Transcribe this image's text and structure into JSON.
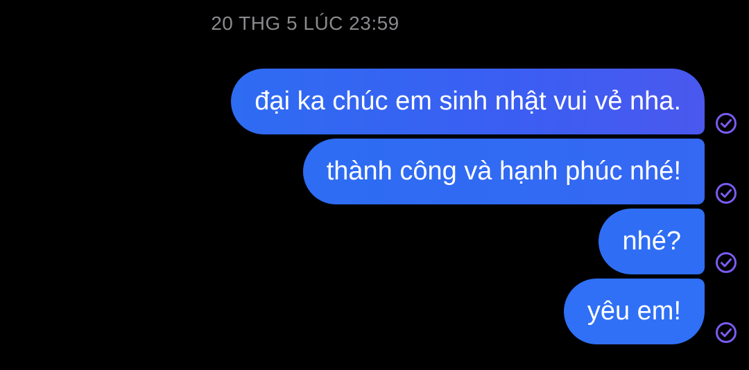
{
  "conversation": {
    "timestamp": "20 THG 5 LÚC 23:59",
    "messages": [
      {
        "text": "đại ka chúc em sinh nhật vui vẻ nha.",
        "status_icon": "sent-check-icon"
      },
      {
        "text": "thành công và hạnh phúc nhé!",
        "status_icon": "sent-check-icon"
      },
      {
        "text": "nhé?",
        "status_icon": "sent-check-icon"
      },
      {
        "text": "yêu em!",
        "status_icon": "sent-check-icon"
      }
    ]
  },
  "colors": {
    "background": "#000000",
    "bubble": "#2f6ef4",
    "timestamp_text": "#8a8a8e",
    "check_icon": "#7b5cf2"
  }
}
